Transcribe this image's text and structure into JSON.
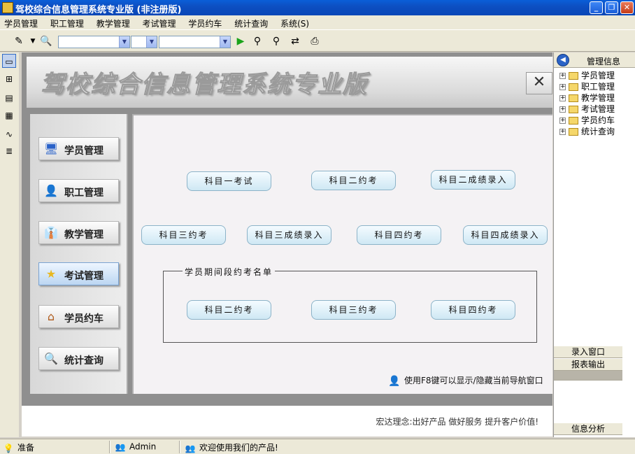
{
  "window": {
    "title": "驾校综合信息管理系统专业版 (非注册版)"
  },
  "menu": [
    "学员管理",
    "职工管理",
    "教学管理",
    "考试管理",
    "学员约车",
    "统计查询",
    "系统(S)"
  ],
  "banner": {
    "title": "驾校综合信息管理系统专业版"
  },
  "nav": [
    {
      "label": "学员管理",
      "icon": "monitor-icon"
    },
    {
      "label": "职工管理",
      "icon": "user-icon"
    },
    {
      "label": "教学管理",
      "icon": "teacher-icon"
    },
    {
      "label": "考试管理",
      "icon": "star-icon",
      "active": true
    },
    {
      "label": "学员约车",
      "icon": "home-icon"
    },
    {
      "label": "统计查询",
      "icon": "search-icon"
    }
  ],
  "actions": {
    "row1": [
      "科目一考试",
      "科目二约考",
      "科目二成绩录入"
    ],
    "row2": [
      "科目三约考",
      "科目三成绩录入",
      "科目四约考",
      "科目四成绩录入"
    ],
    "group_title": "学员期间段约考名单",
    "group": [
      "科目二约考",
      "科目三约考",
      "科目四约考"
    ]
  },
  "hint": "使用F8键可以显示/隐藏当前导航窗口",
  "slogan": "宏达理念:出好产品 做好服务 提升客户价值!",
  "right_panel": {
    "title": "管理信息",
    "tree": [
      "学员管理",
      "职工管理",
      "教学管理",
      "考试管理",
      "学员约车",
      "统计查询"
    ],
    "buttons": [
      "录入窗口",
      "报表输出",
      "信息分析"
    ]
  },
  "status": {
    "state": "准备",
    "user": "Admin",
    "welcome": "欢迎使用我们的产品!"
  },
  "colors": {
    "title_bar": "#0846b7",
    "pill_border": "#8cb3c8",
    "active_nav": "#bcd6f2"
  }
}
